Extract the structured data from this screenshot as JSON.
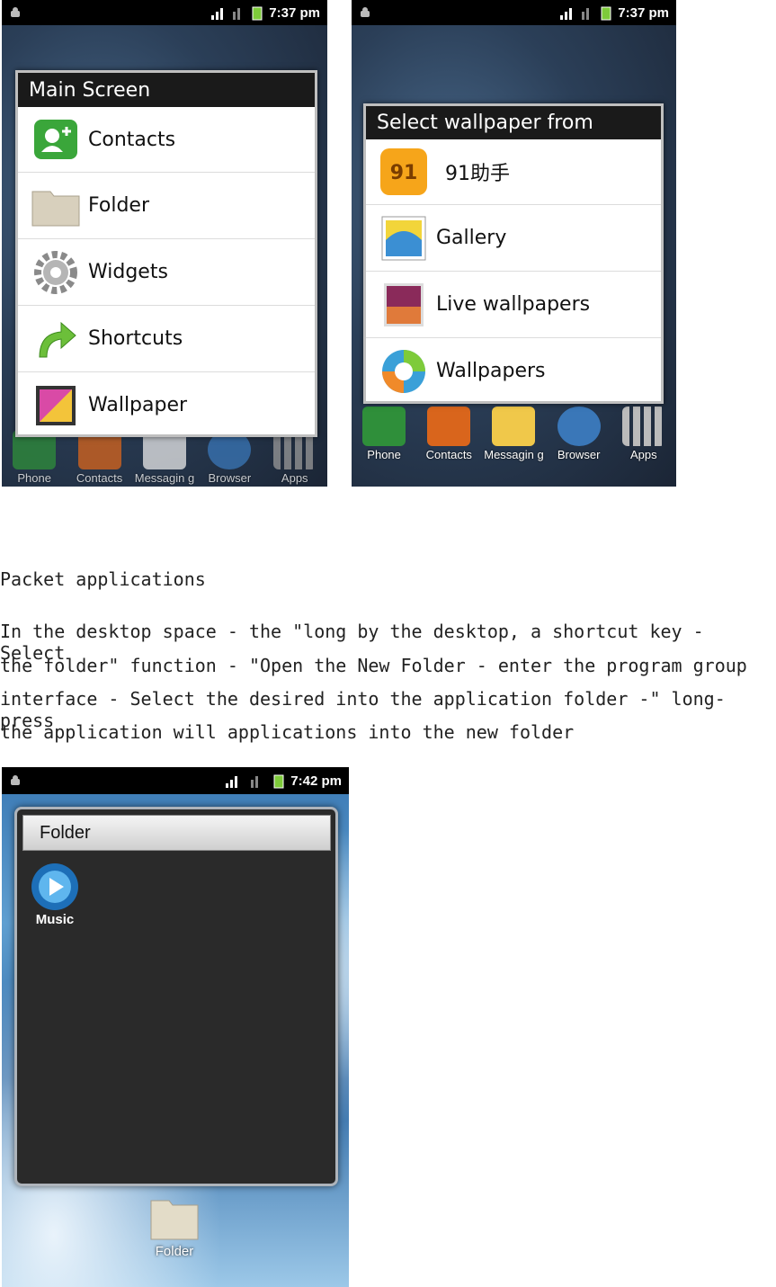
{
  "shot1": {
    "status_time": "7:37 pm",
    "dialog_title": "Main Screen",
    "items": [
      {
        "label": "Contacts",
        "icon": "contacts-add-icon"
      },
      {
        "label": "Folder",
        "icon": "folder-icon"
      },
      {
        "label": "Widgets",
        "icon": "gear-icon"
      },
      {
        "label": "Shortcuts",
        "icon": "arrow-shortcut-icon"
      },
      {
        "label": "Wallpaper",
        "icon": "wallpaper-icon"
      }
    ],
    "dock": [
      "Phone",
      "Contacts",
      "Messagin g",
      "Browser",
      "Apps"
    ]
  },
  "shot2": {
    "status_time": "7:37 pm",
    "dialog_title": "Select wallpaper from",
    "items": [
      {
        "label": "91助手",
        "icon": "91-assistant-icon"
      },
      {
        "label": "Gallery",
        "icon": "gallery-icon"
      },
      {
        "label": "Live wallpapers",
        "icon": "live-wallpaper-icon"
      },
      {
        "label": "Wallpapers",
        "icon": "wallpapers-icon"
      }
    ],
    "dock": [
      "Phone",
      "Contacts",
      "Messagin g",
      "Browser",
      "Apps"
    ]
  },
  "section_heading": "Packet applications",
  "body_lines": [
    "In the desktop space - the \"long by the desktop, a shortcut key - Select",
    "the folder\" function - \"Open the New Folder - enter the program group",
    "interface - Select the desired into the application folder -\" long-press",
    "the application will applications into the new folder"
  ],
  "shot3": {
    "status_time": "7:42 pm",
    "folder_title": "Folder",
    "app_label": "Music",
    "desktop_folder_label": "Folder"
  },
  "colors": {
    "status_bar": "#000000",
    "dialog_title_bg": "#1a1a1a",
    "folder_bg": "#2a2a2a"
  }
}
